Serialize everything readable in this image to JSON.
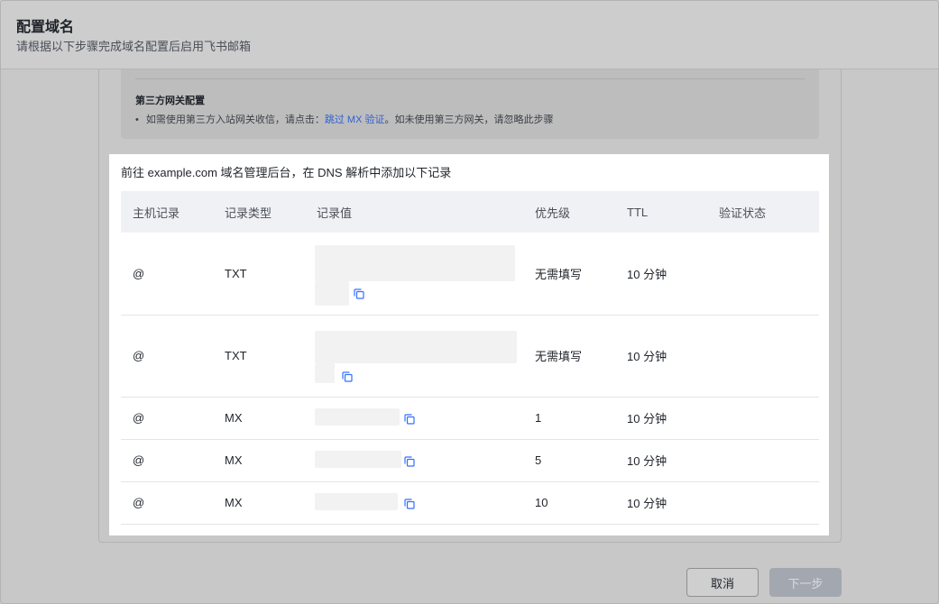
{
  "header": {
    "title": "配置域名",
    "subtitle": "请根据以下步骤完成域名配置后启用飞书邮箱"
  },
  "gateway_note": {
    "title": "第三方网关配置",
    "text_prefix": "如需使用第三方入站网关收信，请点击：",
    "link": "跳过 MX 验证",
    "text_suffix": "。如未使用第三方网关，请忽略此步骤"
  },
  "dns": {
    "intro": "前往 example.com 域名管理后台，在 DNS 解析中添加以下记录",
    "columns": [
      "主机记录",
      "记录类型",
      "记录值",
      "优先级",
      "TTL",
      "验证状态"
    ],
    "rows": [
      {
        "host": "@",
        "type": "TXT",
        "priority": "无需填写",
        "ttl": "10 分钟",
        "status": ""
      },
      {
        "host": "@",
        "type": "TXT",
        "priority": "无需填写",
        "ttl": "10 分钟",
        "status": ""
      },
      {
        "host": "@",
        "type": "MX",
        "priority": "1",
        "ttl": "10 分钟",
        "status": ""
      },
      {
        "host": "@",
        "type": "MX",
        "priority": "5",
        "ttl": "10 分钟",
        "status": ""
      },
      {
        "host": "@",
        "type": "MX",
        "priority": "10",
        "ttl": "10 分钟",
        "status": ""
      }
    ]
  },
  "footer": {
    "cancel": "取消",
    "next": "下一步"
  },
  "colors": {
    "link": "#2f5fd0",
    "copy_icon": "#3370ff"
  }
}
